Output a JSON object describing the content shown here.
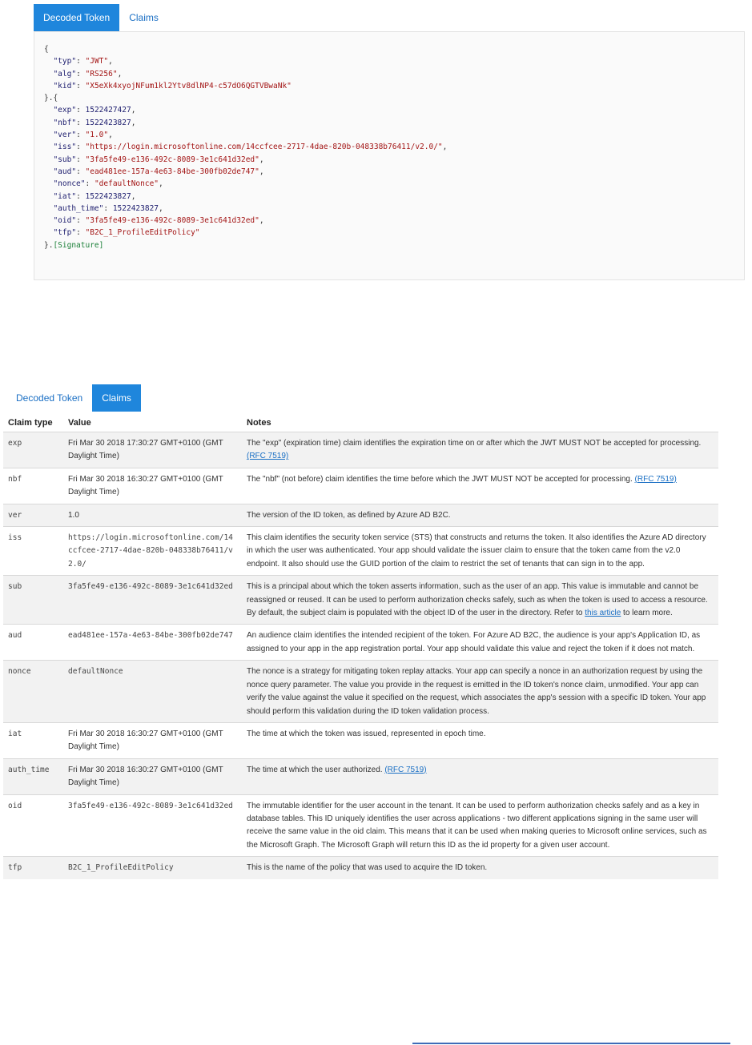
{
  "top_tabs": {
    "decoded_token": "Decoded Token",
    "claims": "Claims"
  },
  "bottom_tabs": {
    "decoded_token": "Decoded Token",
    "claims": "Claims"
  },
  "token": {
    "header": [
      {
        "key": "typ",
        "value": "JWT"
      },
      {
        "key": "alg",
        "value": "RS256"
      },
      {
        "key": "kid",
        "value": "X5eXk4xyojNFum1kl2Ytv8dlNP4-c57dO6QGTVBwaNk"
      }
    ],
    "payload": [
      {
        "key": "exp",
        "value": "1522427427",
        "type": "number"
      },
      {
        "key": "nbf",
        "value": "1522423827",
        "type": "number"
      },
      {
        "key": "ver",
        "value": "1.0",
        "type": "string"
      },
      {
        "key": "iss",
        "value": "https://login.microsoftonline.com/14ccfcee-2717-4dae-820b-048338b76411/v2.0/",
        "type": "string"
      },
      {
        "key": "sub",
        "value": "3fa5fe49-e136-492c-8089-3e1c641d32ed",
        "type": "string"
      },
      {
        "key": "aud",
        "value": "ead481ee-157a-4e63-84be-300fb02de747",
        "type": "string"
      },
      {
        "key": "nonce",
        "value": "defaultNonce",
        "type": "string"
      },
      {
        "key": "iat",
        "value": "1522423827",
        "type": "number"
      },
      {
        "key": "auth_time",
        "value": "1522423827",
        "type": "number"
      },
      {
        "key": "oid",
        "value": "3fa5fe49-e136-492c-8089-3e1c641d32ed",
        "type": "string"
      },
      {
        "key": "tfp",
        "value": "B2C_1_ProfileEditPolicy",
        "type": "string"
      }
    ],
    "signature": "[Signature]"
  },
  "claims_table": {
    "headers": [
      "Claim type",
      "Value",
      "Notes"
    ],
    "rows": [
      {
        "claim": "exp",
        "value": "Fri Mar 30 2018 17:30:27 GMT+0100 (GMT Daylight Time)",
        "value_mono": false,
        "notes": "The \"exp\" (expiration time) claim identifies the expiration time on or after which the JWT MUST NOT be accepted for processing. ",
        "link": "(RFC 7519)",
        "notes_after": ""
      },
      {
        "claim": "nbf",
        "value": "Fri Mar 30 2018 16:30:27 GMT+0100 (GMT Daylight Time)",
        "value_mono": false,
        "notes": "The \"nbf\" (not before) claim identifies the time before which the JWT MUST NOT be accepted for processing. ",
        "link": "(RFC 7519)",
        "notes_after": ""
      },
      {
        "claim": "ver",
        "value": "1.0",
        "value_mono": false,
        "notes": "The version of the ID token, as defined by Azure AD B2C.",
        "link": "",
        "notes_after": ""
      },
      {
        "claim": "iss",
        "value": "https://login.microsoftonline.com/14ccfcee-2717-4dae-820b-048338b76411/v2.0/",
        "value_mono": true,
        "notes": "This claim identifies the security token service (STS) that constructs and returns the token. It also identifies the Azure AD directory in which the user was authenticated. Your app should validate the issuer claim to ensure that the token came from the v2.0 endpoint. It also should use the GUID portion of the claim to restrict the set of tenants that can sign in to the app.",
        "link": "",
        "notes_after": ""
      },
      {
        "claim": "sub",
        "value": "3fa5fe49-e136-492c-8089-3e1c641d32ed",
        "value_mono": true,
        "notes": "This is a principal about which the token asserts information, such as the user of an app. This value is immutable and cannot be reassigned or reused. It can be used to perform authorization checks safely, such as when the token is used to access a resource. By default, the subject claim is populated with the object ID of the user in the directory. Refer to ",
        "link": "this article",
        "notes_after": " to learn more."
      },
      {
        "claim": "aud",
        "value": "ead481ee-157a-4e63-84be-300fb02de747",
        "value_mono": true,
        "notes": "An audience claim identifies the intended recipient of the token. For Azure AD B2C, the audience is your app's Application ID, as assigned to your app in the app registration portal. Your app should validate this value and reject the token if it does not match.",
        "link": "",
        "notes_after": ""
      },
      {
        "claim": "nonce",
        "value": "defaultNonce",
        "value_mono": true,
        "notes": "The nonce is a strategy for mitigating token replay attacks. Your app can specify a nonce in an authorization request by using the nonce query parameter. The value you provide in the request is emitted in the ID token's nonce claim, unmodified. Your app can verify the value against the value it specified on the request, which associates the app's session with a specific ID token. Your app should perform this validation during the ID token validation process.",
        "link": "",
        "notes_after": ""
      },
      {
        "claim": "iat",
        "value": "Fri Mar 30 2018 16:30:27 GMT+0100 (GMT Daylight Time)",
        "value_mono": false,
        "notes": "The time at which the token was issued, represented in epoch time.",
        "link": "",
        "notes_after": ""
      },
      {
        "claim": "auth_time",
        "value": "Fri Mar 30 2018 16:30:27 GMT+0100 (GMT Daylight Time)",
        "value_mono": false,
        "notes": "The time at which the user authorized. ",
        "link": "(RFC 7519)",
        "notes_after": ""
      },
      {
        "claim": "oid",
        "value": "3fa5fe49-e136-492c-8089-3e1c641d32ed",
        "value_mono": true,
        "notes": "The immutable identifier for the user account in the tenant. It can be used to perform authorization checks safely and as a key in database tables. This ID uniquely identifies the user across applications - two different applications signing in the same user will receive the same value in the oid claim. This means that it can be used when making queries to Microsoft online services, such as the Microsoft Graph. The Microsoft Graph will return this ID as the id property for a given user account.",
        "link": "",
        "notes_after": ""
      },
      {
        "claim": "tfp",
        "value": "B2C_1_ProfileEditPolicy",
        "value_mono": true,
        "notes": "This is the name of the policy that was used to acquire the ID token.",
        "link": "",
        "notes_after": ""
      }
    ]
  },
  "colors": {
    "accent": "#1f86dc",
    "link": "#1a6fc4",
    "json_string": "#a31515",
    "json_key": "#1d1d6e",
    "signature": "#1a7f37"
  }
}
